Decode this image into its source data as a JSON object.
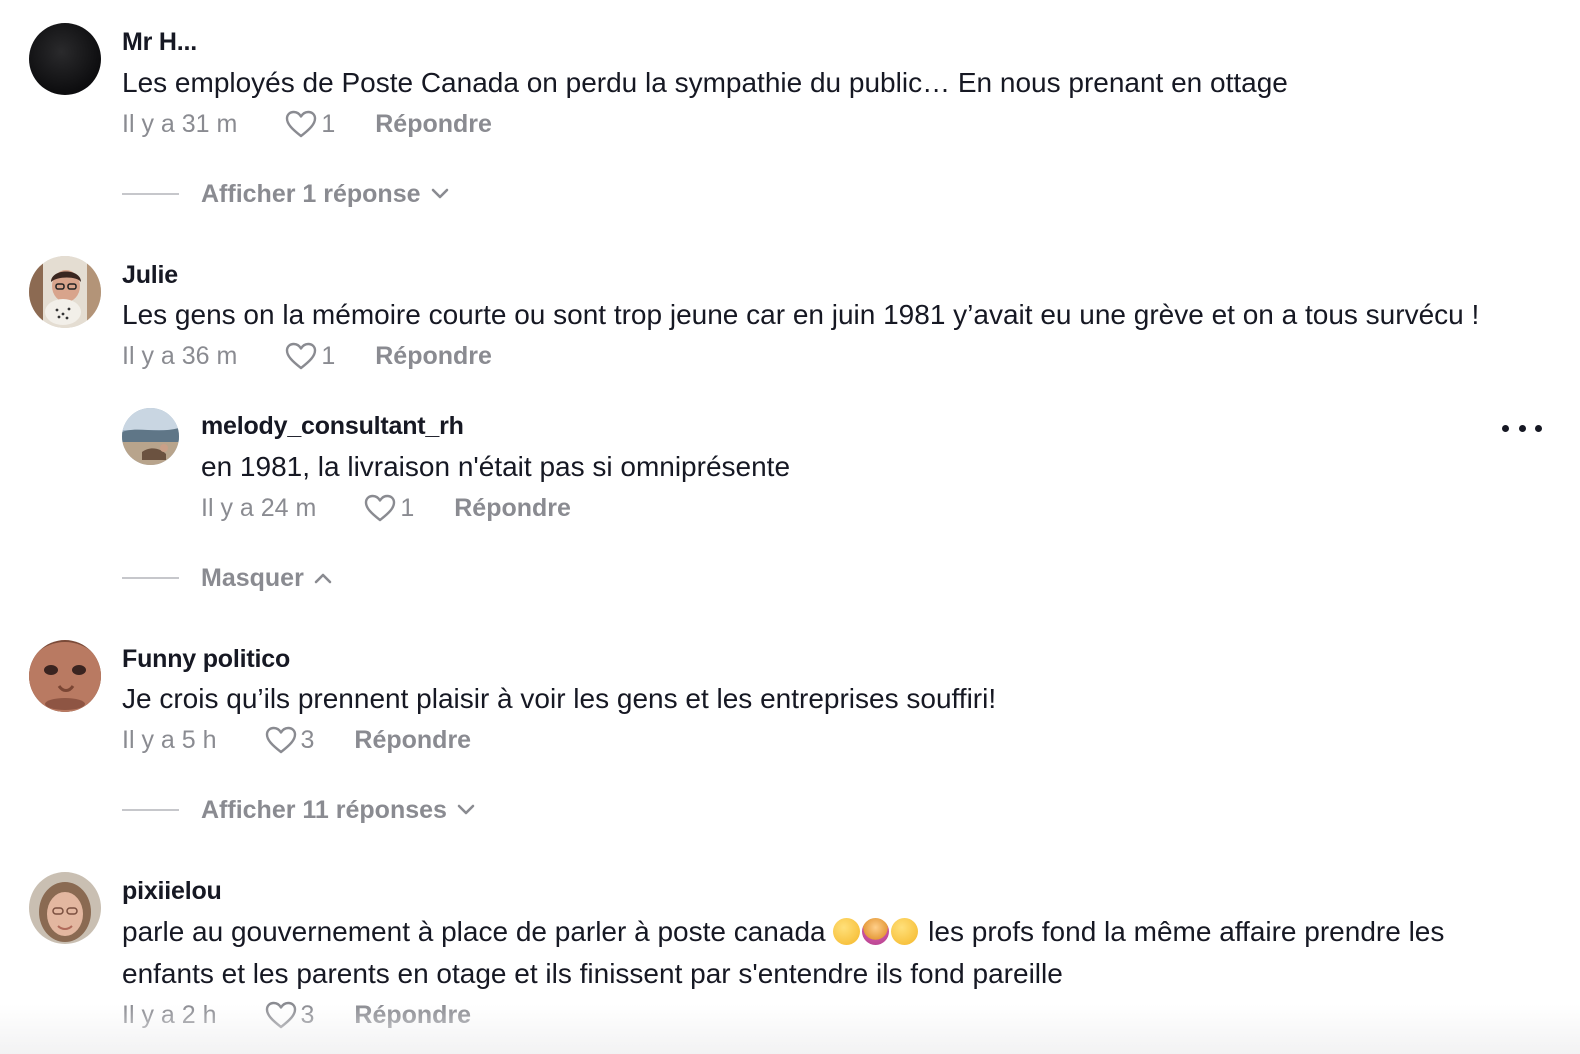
{
  "comments": [
    {
      "username": "Mr H...",
      "text": "Les employés de Poste Canada on perdu la sympathie du public… En nous prenant en ottage",
      "time": "Il y a 31 m",
      "likes": "1",
      "reply_label": "Répondre",
      "replies_toggle": "Afficher 1 réponse"
    },
    {
      "username": "Julie",
      "text": "Les gens on la mémoire courte ou sont trop jeune car en juin 1981 y’avait eu une grève et on a tous survécu !",
      "time": "Il y a 36 m",
      "likes": "1",
      "reply_label": "Répondre",
      "replies": [
        {
          "username": "melody_consultant_rh",
          "text": "en 1981, la livraison n'était pas si omniprésente",
          "time": "Il y a 24 m",
          "likes": "1",
          "reply_label": "Répondre"
        }
      ],
      "replies_toggle": "Masquer"
    },
    {
      "username": "Funny politico",
      "text": "Je crois qu’ils prennent plaisir à voir les gens et les entreprises souffiri!",
      "time": "Il y a 5 h",
      "likes": "3",
      "reply_label": "Répondre",
      "replies_toggle": "Afficher 11 réponses"
    },
    {
      "username": "pixiielou",
      "text_part1": "parle au gouvernement à place de parler à poste canada",
      "text_part2": "les profs fond la même affaire prendre les",
      "text_line2": "enfants et les parents en otage et ils finissent par s'entendre ils fond pareille",
      "emojis": [
        "relieved-face-emoji",
        "facepalm-woman-emoji",
        "grinning-sweat-emoji"
      ],
      "time": "Il y a 2 h",
      "likes": "3",
      "reply_label": "Répondre"
    }
  ],
  "colors": {
    "text": "#161823",
    "secondary": "#8a8b91",
    "divider": "#c6c7cb"
  }
}
